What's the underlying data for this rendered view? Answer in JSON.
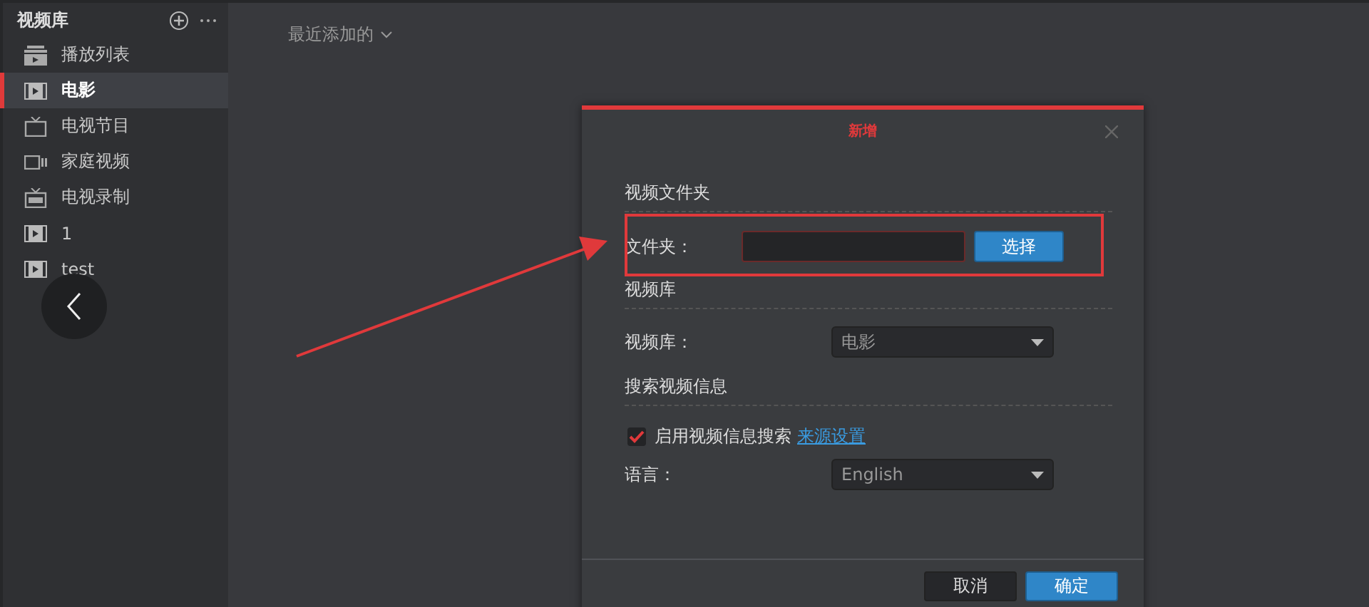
{
  "sidebar": {
    "title": "视频库",
    "items": [
      {
        "label": "播放列表",
        "kind": "playlist",
        "selected": false
      },
      {
        "label": "电影",
        "kind": "movie",
        "selected": true
      },
      {
        "label": "电视节目",
        "kind": "tv",
        "selected": false
      },
      {
        "label": "家庭视频",
        "kind": "camera",
        "selected": false
      },
      {
        "label": "电视录制",
        "kind": "recording",
        "selected": false
      },
      {
        "label": "1",
        "kind": "movie",
        "selected": false
      },
      {
        "label": "test",
        "kind": "movie",
        "selected": false
      }
    ]
  },
  "main": {
    "sort_label": "最近添加的"
  },
  "dialog": {
    "title": "新增",
    "folder": {
      "title": "视频文件夹",
      "label": "文件夹：",
      "button": "选择"
    },
    "library": {
      "title": "视频库",
      "label": "视频库：",
      "value": "电影"
    },
    "search": {
      "title": "搜索视频信息",
      "checkbox": {
        "label": "启用视频信息搜索",
        "checked": true
      },
      "link": "来源设置",
      "language": {
        "label": "语言：",
        "value": "English"
      }
    },
    "buttons": [
      {
        "label": "取消",
        "kind": "secondary"
      },
      {
        "label": "确定",
        "kind": "primary"
      }
    ]
  }
}
